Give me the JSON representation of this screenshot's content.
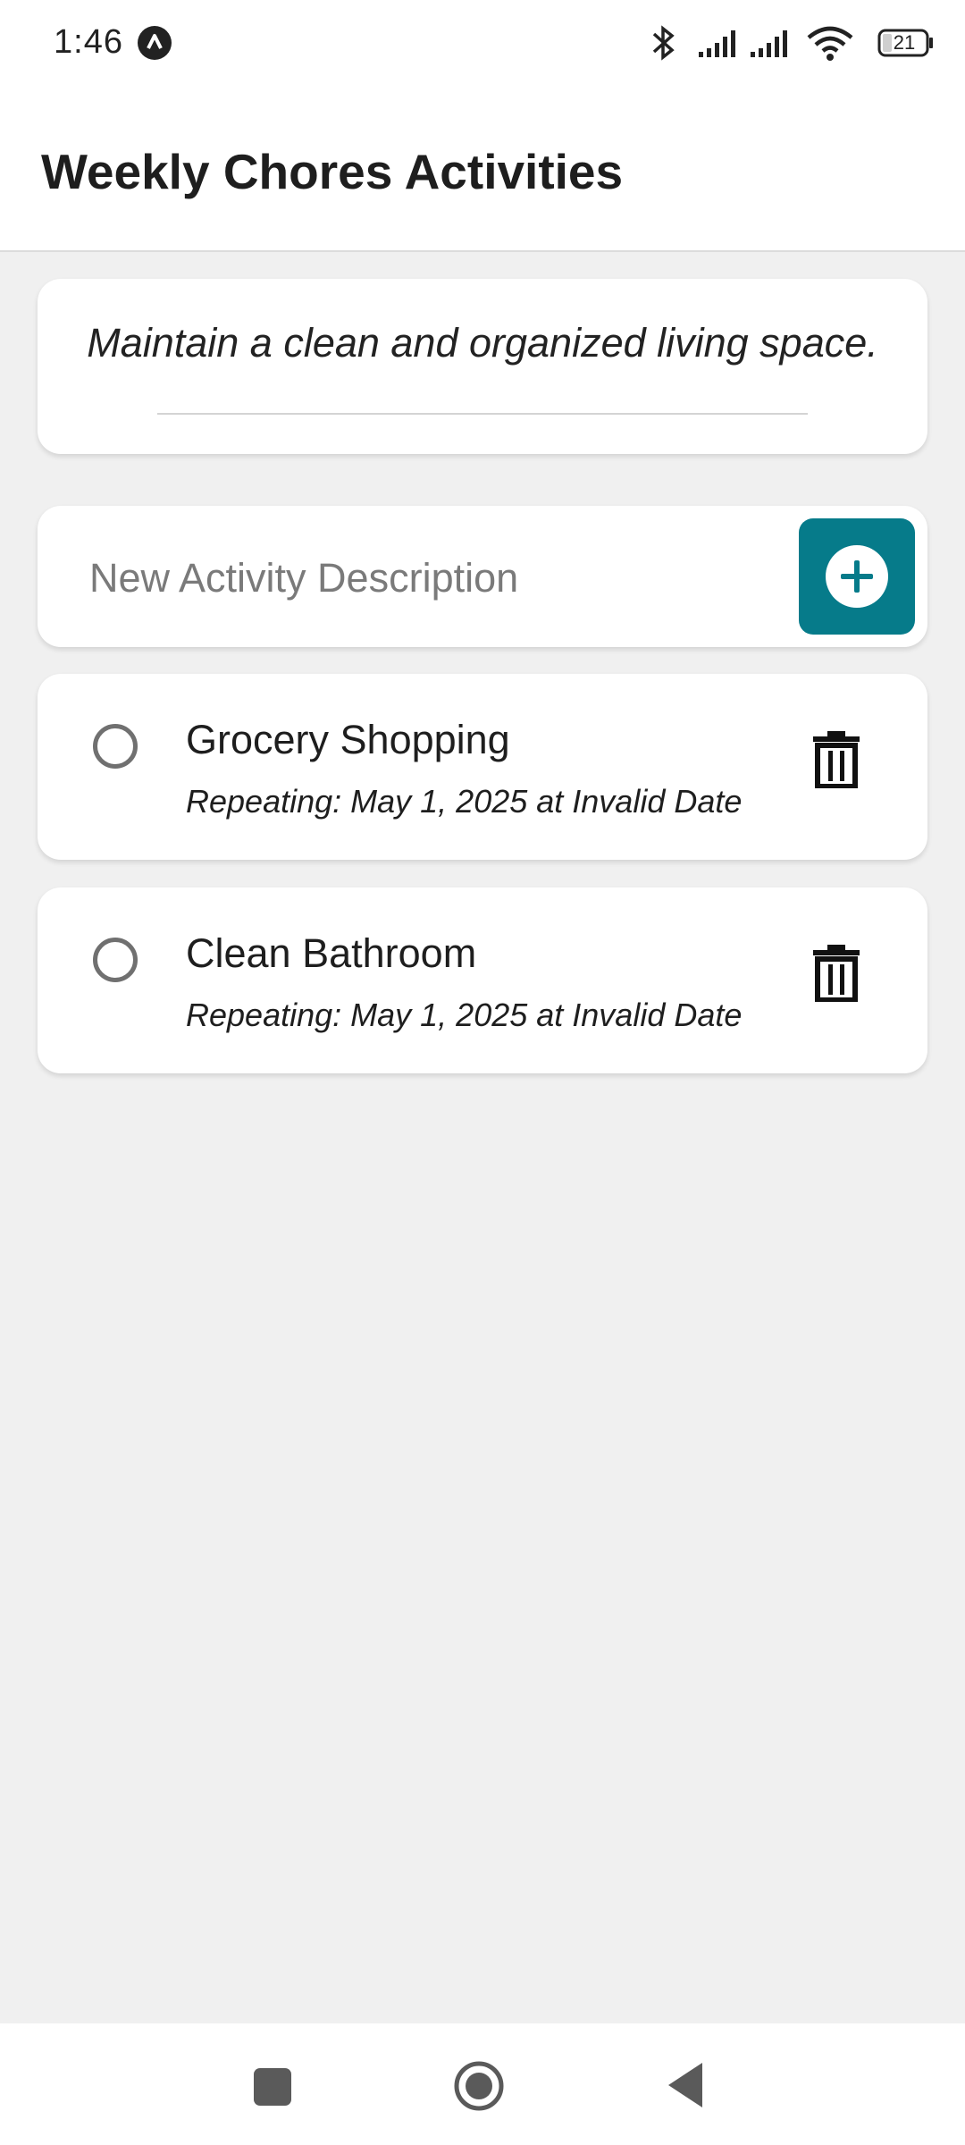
{
  "status_bar": {
    "time": "1:46",
    "battery": "21",
    "icons": [
      "app-notification-icon",
      "bluetooth-icon",
      "signal-icon",
      "signal-icon",
      "wifi-icon",
      "battery-icon"
    ]
  },
  "header": {
    "title": "Weekly Chores Activities"
  },
  "goal": {
    "text": "Maintain a clean and organized living space."
  },
  "new_activity": {
    "placeholder": "New Activity Description",
    "value": "",
    "add_icon": "plus-circle-icon",
    "accent_color": "#067b8a"
  },
  "chores": [
    {
      "title": "Grocery Shopping",
      "subtitle": "Repeating: May 1, 2025 at Invalid Date",
      "completed": false,
      "delete_icon": "trash-icon"
    },
    {
      "title": "Clean Bathroom",
      "subtitle": "Repeating: May 1, 2025 at Invalid Date",
      "completed": false,
      "delete_icon": "trash-icon"
    }
  ],
  "nav_bar": {
    "icons": [
      "recents-square-icon",
      "home-circle-icon",
      "back-triangle-icon"
    ]
  }
}
